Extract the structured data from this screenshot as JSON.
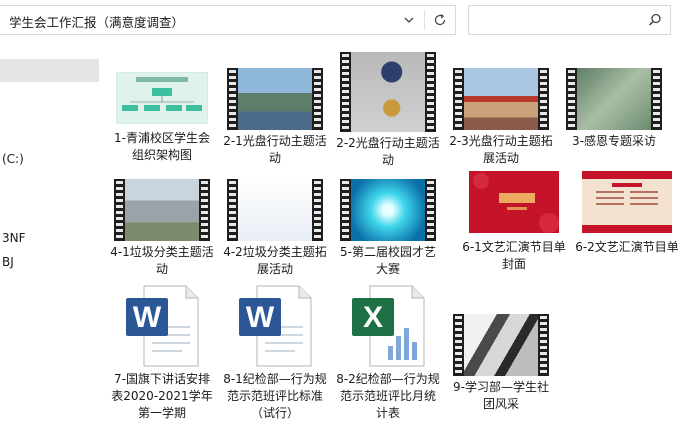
{
  "address": {
    "path": "学生会工作汇报（满意度调查）"
  },
  "nav": {
    "items": [
      "(C:)",
      "3NF",
      "BJ"
    ]
  },
  "colors": {
    "word_blue": "#2b5797",
    "excel_green": "#1e7145",
    "selection": "#e5e5e5"
  },
  "files": [
    {
      "name": "1-青浦校区学生会组织架构图",
      "kind": "image",
      "thumb": "org-chart"
    },
    {
      "name": "2-1光盘行动主题活动",
      "kind": "video",
      "thumb": "crowd-outdoor"
    },
    {
      "name": "2-2光盘行动主题活动",
      "kind": "video",
      "thumb": "person-eating"
    },
    {
      "name": "2-3光盘行动主题拓展活动",
      "kind": "video",
      "thumb": "running-track"
    },
    {
      "name": "3-感恩专题采访",
      "kind": "video",
      "thumb": "green-calligraphy"
    },
    {
      "name": "4-1垃圾分类主题活动",
      "kind": "video",
      "thumb": "building-yard"
    },
    {
      "name": "4-2垃圾分类主题拓展活动",
      "kind": "video",
      "thumb": "slogan-slide"
    },
    {
      "name": "5-第二届校园才艺大赛",
      "kind": "video",
      "thumb": "cyan-burst"
    },
    {
      "name": "6-1文艺汇演节目单封面",
      "kind": "image",
      "thumb": "red-poster"
    },
    {
      "name": "6-2文艺汇演节目单",
      "kind": "image",
      "thumb": "program-sheet"
    },
    {
      "name": "7-国旗下讲话安排表2020-2021学年第一学期",
      "kind": "word",
      "thumb": "word-doc"
    },
    {
      "name": "8-1纪检部—行为规范示范班评比标准（试行）",
      "kind": "word",
      "thumb": "word-doc"
    },
    {
      "name": "8-2纪检部—行为规范示范班评比月统计表",
      "kind": "excel",
      "thumb": "excel-doc"
    },
    {
      "name": "9-学习部—学生社团风采",
      "kind": "video",
      "thumb": "bw-architecture"
    }
  ]
}
